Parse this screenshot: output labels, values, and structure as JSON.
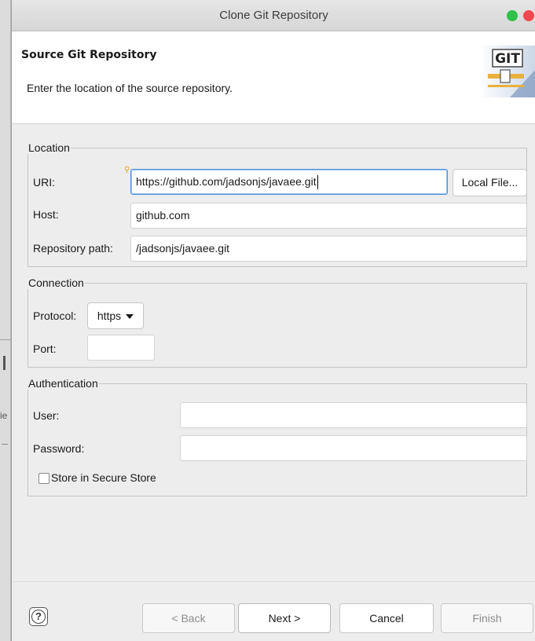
{
  "window": {
    "title": "Clone Git Repository"
  },
  "header": {
    "title": "Source Git Repository",
    "description": "Enter the location of the source repository.",
    "logo_text": "GIT"
  },
  "location": {
    "legend": "Location",
    "uri_label": "URI:",
    "uri_value": "https://github.com/jadsonjs/javaee.git",
    "local_file_button": "Local File...",
    "host_label": "Host:",
    "host_value": "github.com",
    "repo_path_label": "Repository path:",
    "repo_path_value": "/jadsonjs/javaee.git"
  },
  "connection": {
    "legend": "Connection",
    "protocol_label": "Protocol:",
    "protocol_value": "https",
    "port_label": "Port:",
    "port_value": ""
  },
  "authentication": {
    "legend": "Authentication",
    "user_label": "User:",
    "user_value": "",
    "password_label": "Password:",
    "password_value": "",
    "store_label": "Store in Secure Store",
    "store_checked": false
  },
  "buttons": {
    "help": "?",
    "back": "< Back",
    "next": "Next >",
    "cancel": "Cancel",
    "finish": "Finish"
  },
  "colors": {
    "focus_border": "#4a90d9",
    "close_dot": "#f2474d",
    "zoom_dot": "#2fc04a"
  }
}
